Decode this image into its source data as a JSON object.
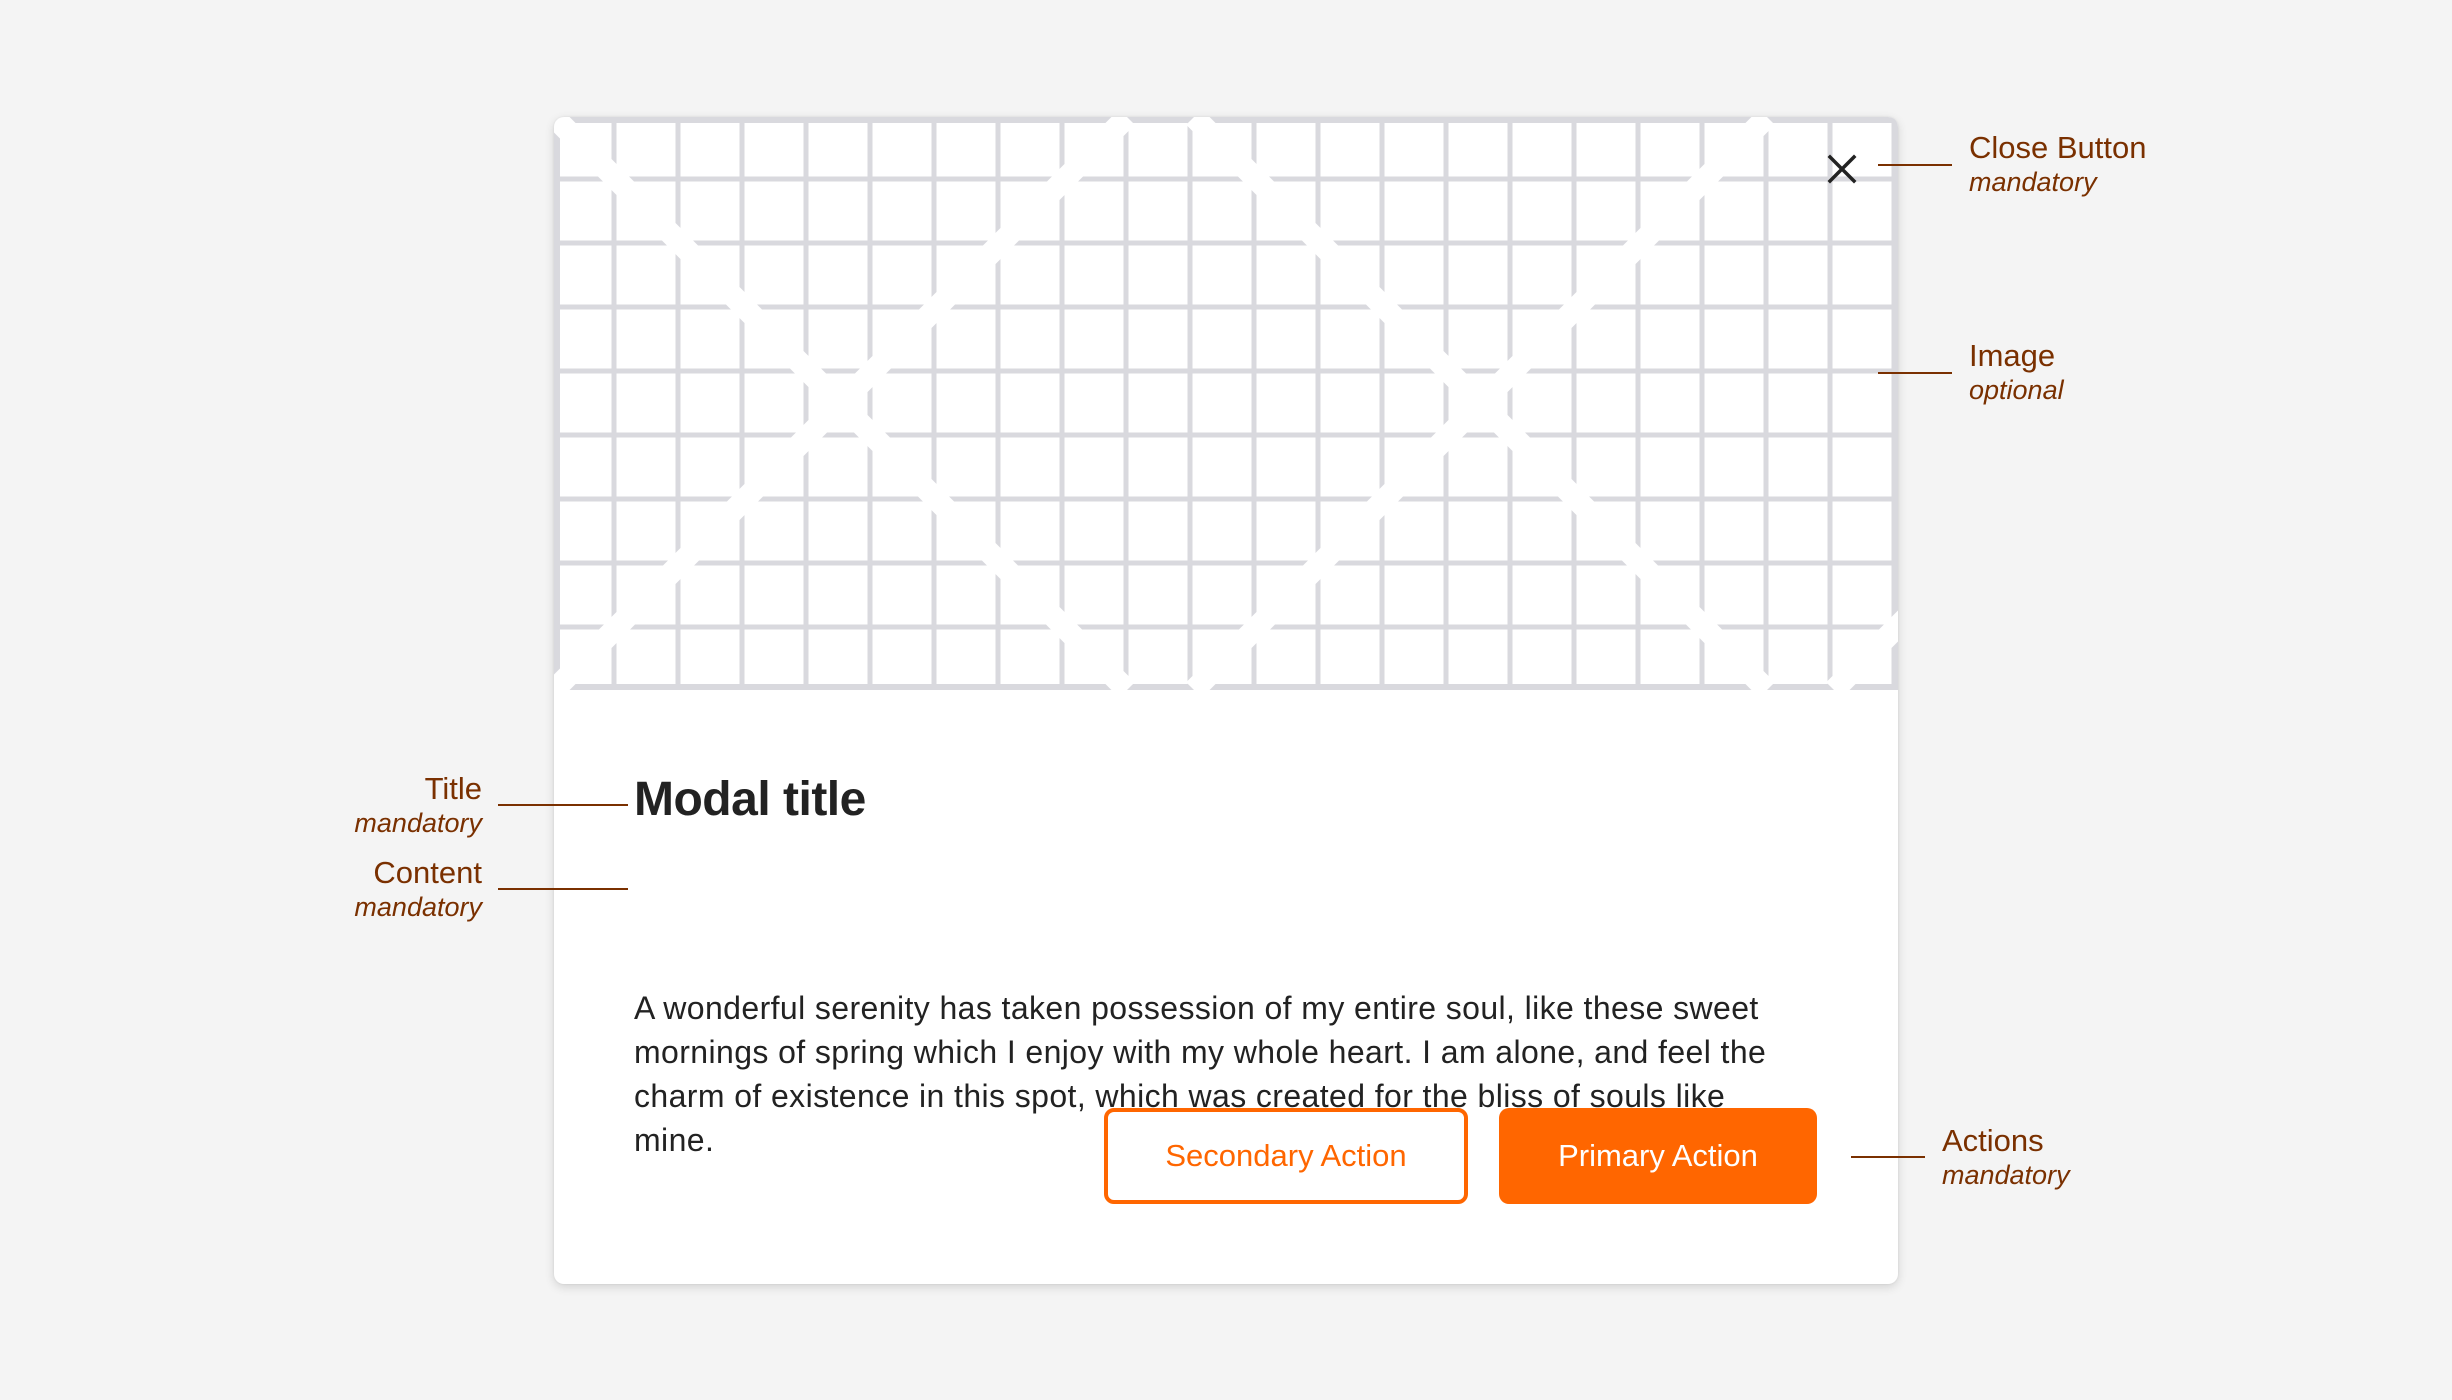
{
  "modal": {
    "close_icon": "close-icon",
    "title": "Modal title",
    "content_lines": [
      "A wonderful serenity has taken possession of my entire soul, like these sweet",
      "mornings of spring which I enjoy with my whole heart. I am alone, and feel the",
      "charm of existence in this spot, which was created for the bliss of souls like",
      "mine."
    ],
    "secondary_action": "Secondary Action",
    "primary_action": "Primary Action"
  },
  "annotations": {
    "close_button": {
      "label": "Close Button",
      "requirement": "mandatory"
    },
    "image": {
      "label": "Image",
      "requirement": "optional"
    },
    "title": {
      "label": "Title",
      "requirement": "mandatory"
    },
    "content": {
      "label": "Content",
      "requirement": "mandatory"
    },
    "actions": {
      "label": "Actions",
      "requirement": "mandatory"
    }
  },
  "colors": {
    "accent": "#ff6600",
    "annotation": "#7a3000",
    "text": "#222222",
    "background": "#f4f4f4",
    "placeholder_grid": "#d9d9de"
  }
}
